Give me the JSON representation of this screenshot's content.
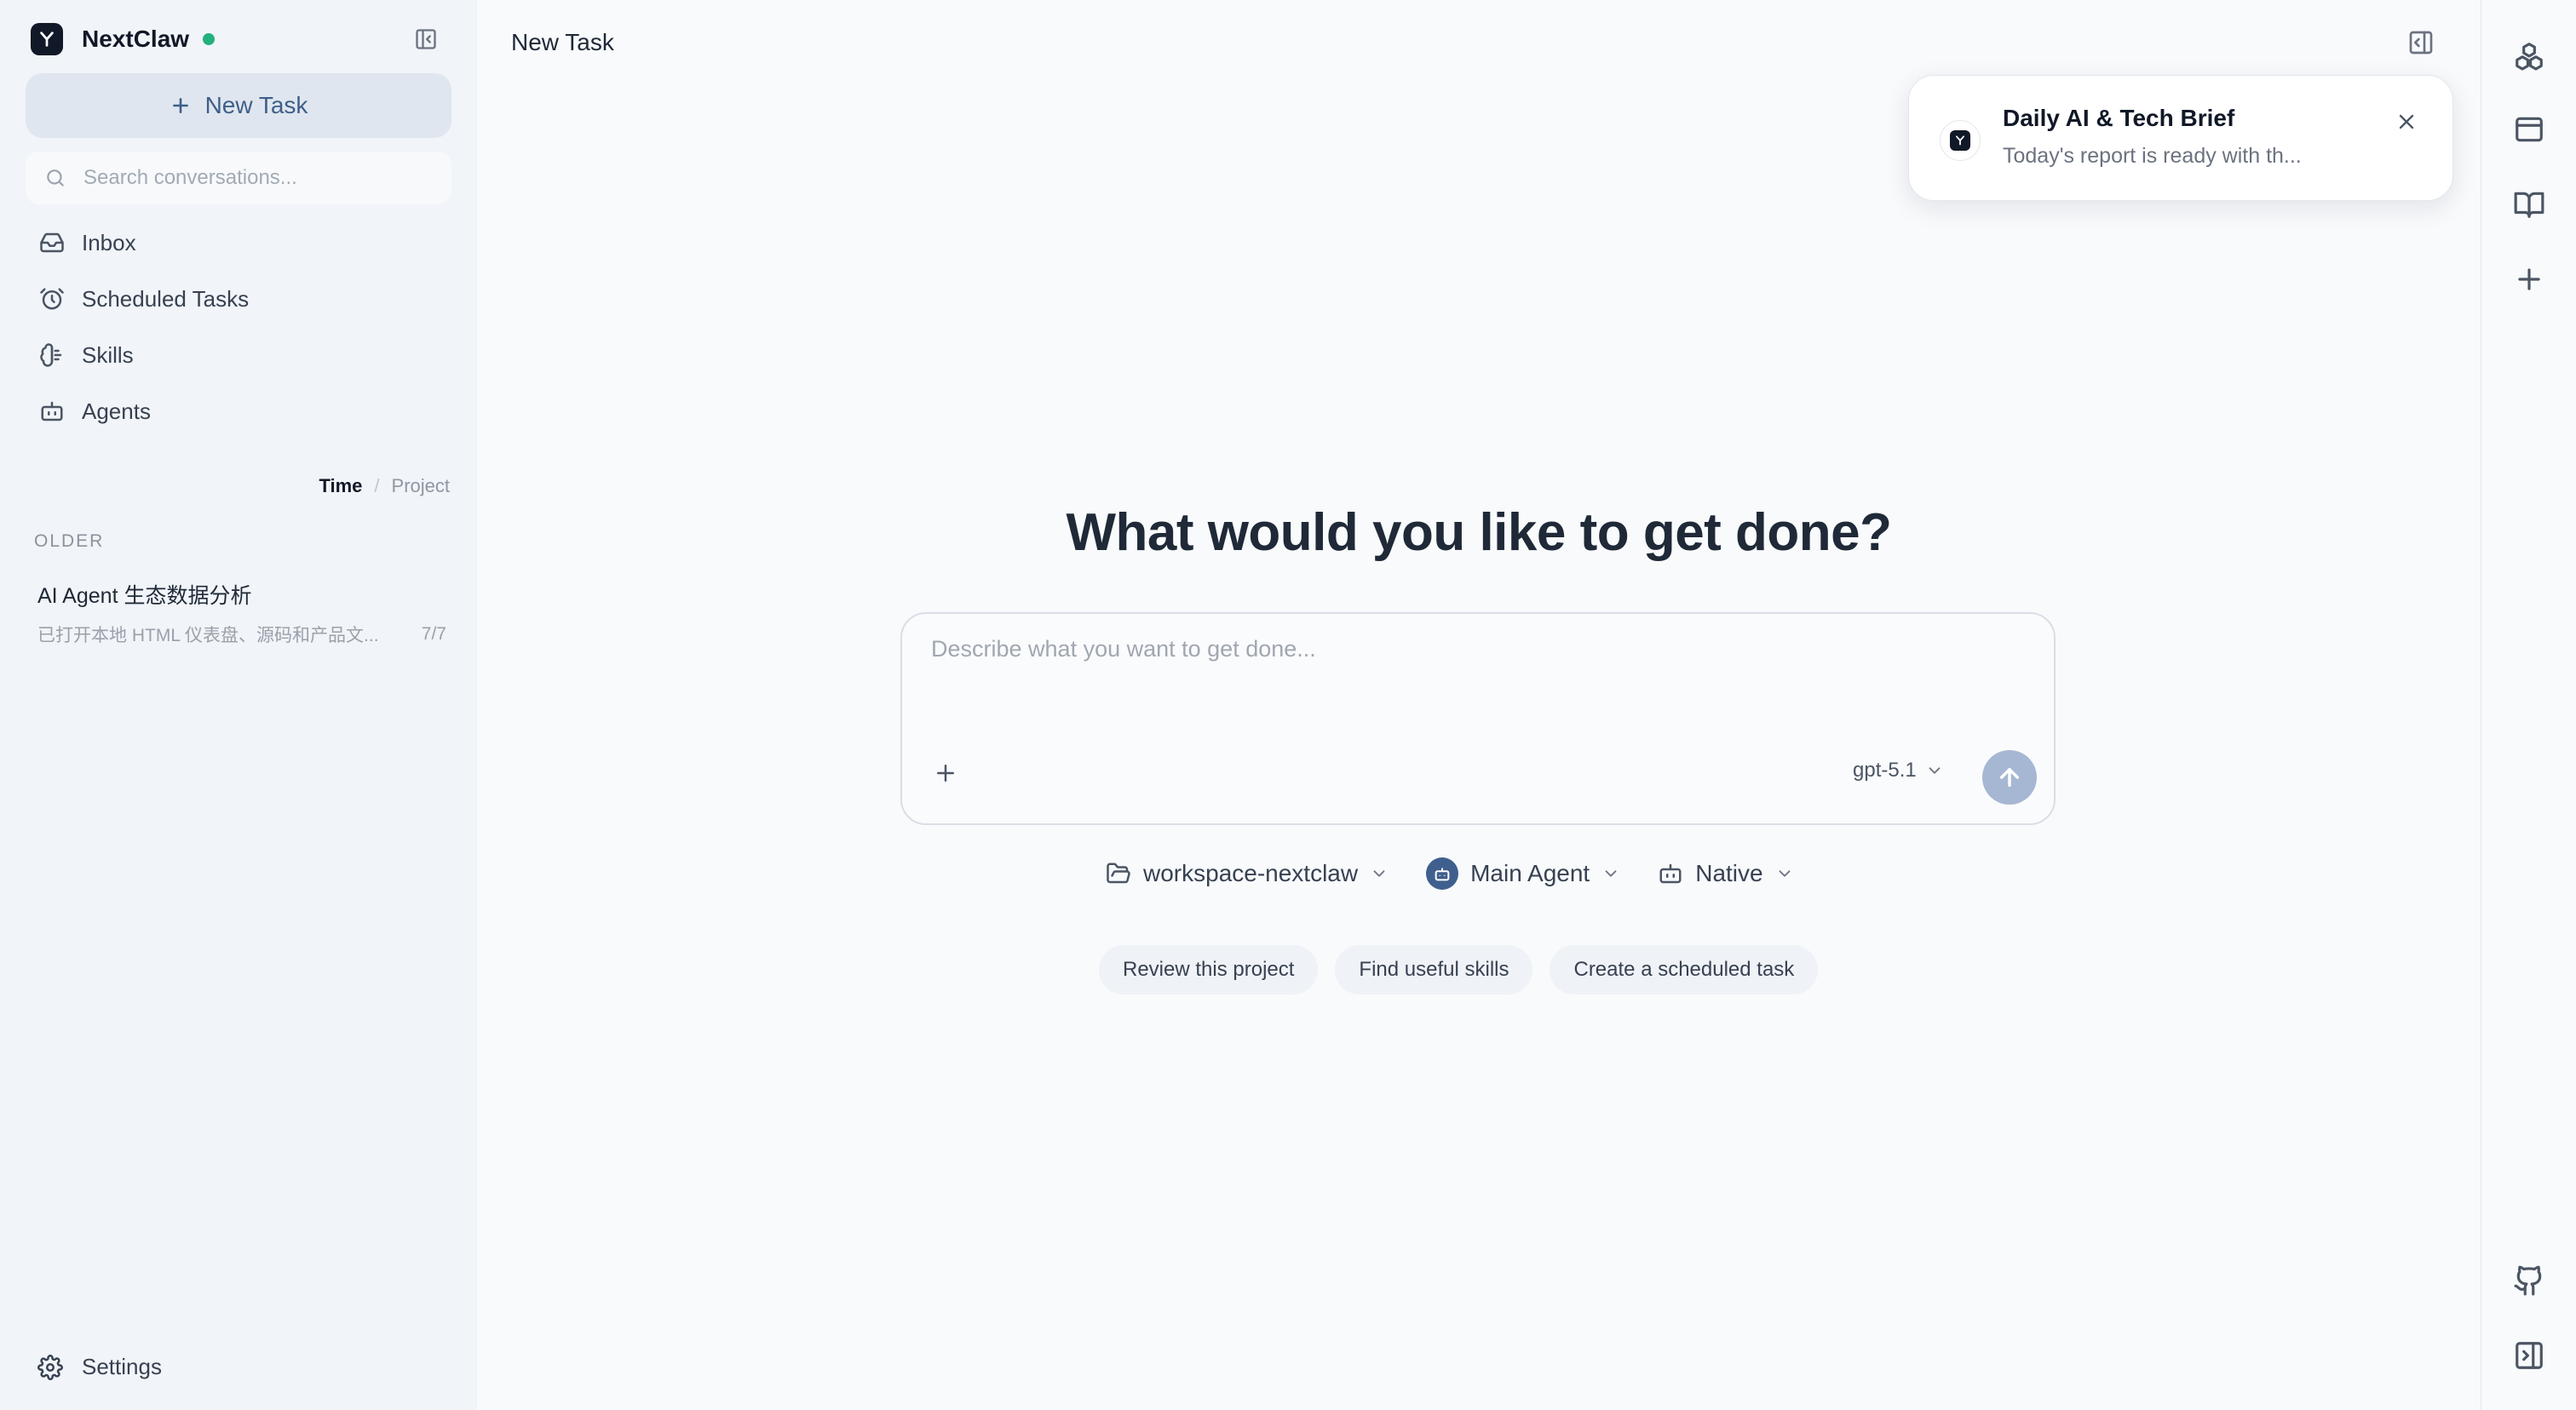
{
  "app": {
    "name": "NextClaw",
    "status_color": "#22b07d"
  },
  "sidebar": {
    "new_task_label": "New Task",
    "search_placeholder": "Search conversations...",
    "nav": [
      {
        "label": "Inbox",
        "icon": "inbox-icon"
      },
      {
        "label": "Scheduled Tasks",
        "icon": "alarm-clock-icon"
      },
      {
        "label": "Skills",
        "icon": "brain-icon"
      },
      {
        "label": "Agents",
        "icon": "bot-icon"
      }
    ],
    "sort": {
      "active": "Time",
      "separator": "/",
      "inactive": "Project"
    },
    "group_label": "OLDER",
    "conversations": [
      {
        "title": "AI Agent 生态数据分析",
        "subtitle": "已打开本地 HTML 仪表盘、源码和产品文...",
        "count": "7/7"
      }
    ],
    "settings_label": "Settings"
  },
  "main": {
    "title": "New Task",
    "hero": "What would you like to get done?",
    "composer": {
      "placeholder": "Describe what you want to get done...",
      "model": "gpt-5.1",
      "send_color": "#a6b7d4"
    },
    "context": {
      "workspace": "workspace-nextclaw",
      "agent": "Main Agent",
      "runtime": "Native"
    },
    "suggestions": [
      "Review this project",
      "Find useful skills",
      "Create a scheduled task"
    ]
  },
  "toast": {
    "title": "Daily AI & Tech Brief",
    "body": "Today's report is ready with th..."
  },
  "rail": {
    "icons": [
      "boxes-icon",
      "browser-window-icon",
      "book-open-icon",
      "plus-icon",
      "github-icon",
      "panel-right-icon"
    ]
  }
}
